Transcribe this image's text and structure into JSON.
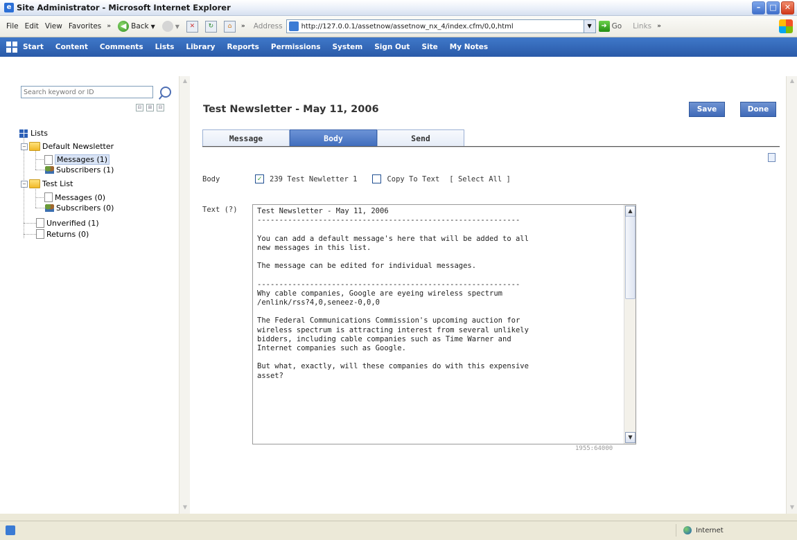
{
  "window": {
    "title": "Site Administrator - Microsoft Internet Explorer",
    "controls": [
      "–",
      "□",
      "✕"
    ]
  },
  "menubar": {
    "items": [
      "File",
      "Edit",
      "View",
      "Favorites"
    ],
    "overflow": "»"
  },
  "toolbar": {
    "back_label": "Back",
    "address_label": "Address",
    "address_value": "http://127.0.0.1/assetnow/assetnow_nx_4/index.cfm/0,0,html",
    "go_label": "Go",
    "links_label": "Links",
    "overflow": "»"
  },
  "nav": {
    "items": [
      "Start",
      "Content",
      "Comments",
      "Lists",
      "Library",
      "Reports",
      "Permissions",
      "System",
      "Sign Out",
      "Site",
      "My Notes"
    ]
  },
  "sidebar": {
    "search_placeholder": "Search keyword or ID",
    "tree_controls": [
      "⊟",
      "⊞",
      "⊟"
    ],
    "tree": {
      "root": "Lists",
      "default_newsletter": "Default Newsletter",
      "dn_messages": "Messages (1)",
      "dn_subscribers": "Subscribers (1)",
      "test_list": "Test List",
      "tl_messages": "Messages (0)",
      "tl_subscribers": "Subscribers (0)",
      "unverified": "Unverified (1)",
      "returns": "Returns (0)"
    }
  },
  "main": {
    "title": "Test Newsletter - May 11, 2006",
    "save_label": "Save",
    "done_label": "Done",
    "tabs": [
      {
        "label": "Message",
        "active": false
      },
      {
        "label": "Body",
        "active": true
      },
      {
        "label": "Send",
        "active": false
      }
    ],
    "body_label": "Body",
    "body_option_1": "239 Test Newletter 1",
    "body_option_1_checked": true,
    "copy_to_text": "Copy To Text",
    "copy_to_text_checked": false,
    "select_all": "[ Select All ]",
    "text_label": "Text (?)",
    "text_lines": [
      "Test Newsletter - May 11, 2006",
      "------------------------------------------------------------",
      "",
      "You can add a default message's here that will be added to all",
      "new messages in this list.",
      "",
      "The message can be edited for individual messages.",
      "",
      "------------------------------------------------------------",
      "Why cable companies, Google are eyeing wireless spectrum",
      "/enlink/rss?4,0,seneez-0,0,0",
      "",
      "The Federal Communications Commission's upcoming auction for",
      "wireless spectrum is attracting interest from several unlikely",
      "bidders, including cable companies such as Time Warner and",
      "Internet companies such as Google.",
      "",
      "But what, exactly, will these companies do with this expensive",
      "asset?"
    ],
    "char_count": "1955:64000"
  },
  "statusbar": {
    "zone": "Internet"
  }
}
